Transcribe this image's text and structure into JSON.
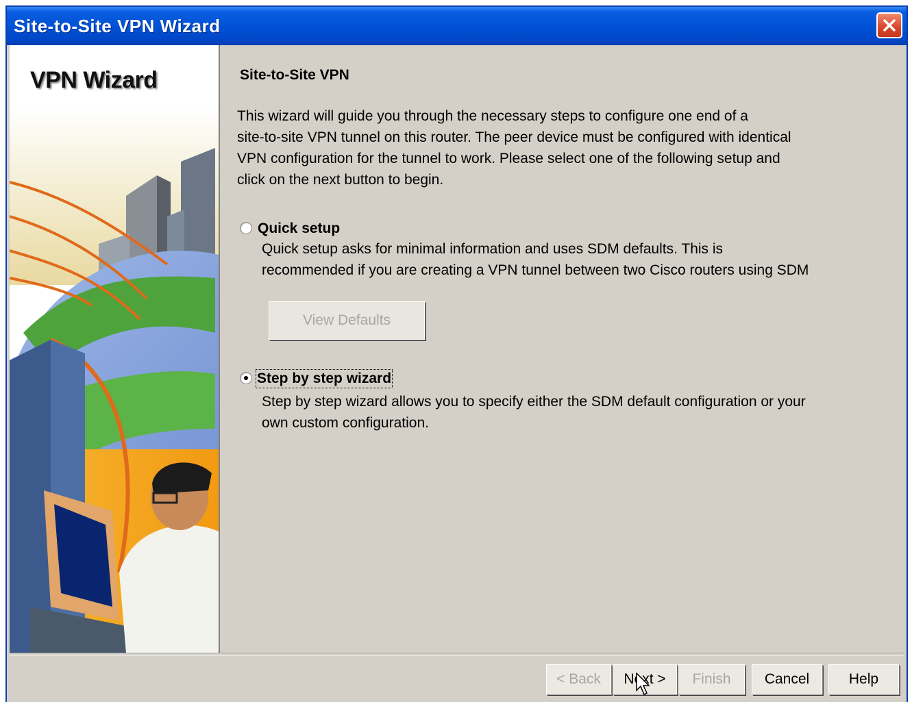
{
  "window": {
    "title": "Site-to-Site VPN Wizard"
  },
  "left_panel": {
    "title": "VPN Wizard"
  },
  "content": {
    "section_title": "Site-to-Site VPN",
    "intro_lines": [
      "This wizard will guide you through the necessary steps to configure one end of a",
      "site-to-site VPN tunnel on this router. The peer device must be configured with identical",
      "VPN configuration for the tunnel to work. Please select one of the following setup and",
      "click on the next button to begin."
    ],
    "quick_setup": {
      "label": "Quick setup",
      "selected": false,
      "desc_lines": [
        "Quick setup asks for minimal information and uses SDM defaults. This is",
        "recommended if you are creating a VPN tunnel between two Cisco routers using SDM"
      ],
      "view_defaults_label": "View Defaults"
    },
    "step_wizard": {
      "label": "Step by step wizard",
      "selected": true,
      "desc_lines": [
        "Step by step wizard allows you to specify either the SDM default configuration or your",
        "own custom configuration."
      ]
    }
  },
  "buttons": {
    "back": "< Back",
    "next": "Next >",
    "finish": "Finish",
    "cancel": "Cancel",
    "help": "Help"
  }
}
